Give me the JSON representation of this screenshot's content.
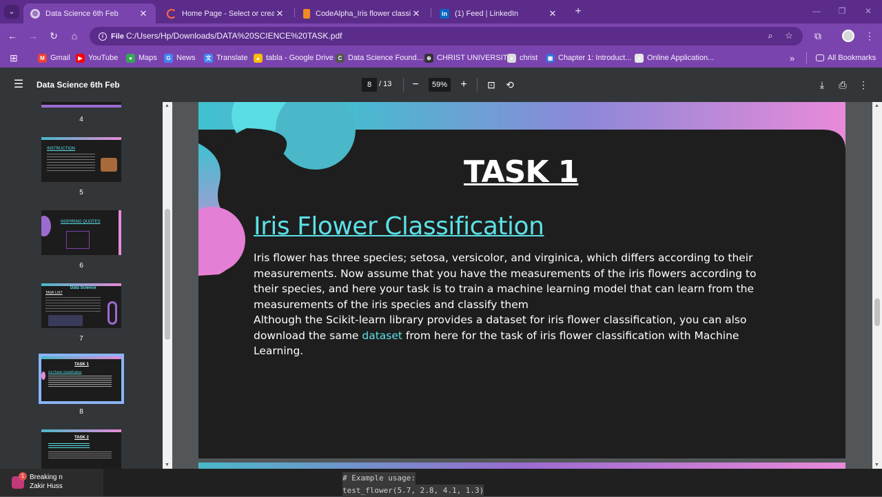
{
  "browser": {
    "tabs": [
      {
        "title": "Data Science 6th Feb",
        "active": true,
        "icon": "globe-icon"
      },
      {
        "title": "Home Page - Select or create a",
        "active": false,
        "icon": "spinner-icon"
      },
      {
        "title": "CodeAlpha_Iris flower classificat",
        "active": false,
        "icon": "document-icon"
      },
      {
        "title": "(1) Feed | LinkedIn",
        "active": false,
        "icon": "linkedin-icon"
      }
    ],
    "omnibox": {
      "chip": "File",
      "url": "C:/Users/Hp/Downloads/DATA%20SCIENCE%20TASK.pdf"
    },
    "bookmarks": [
      {
        "label": "Gmail",
        "color": "#ea4335",
        "glyph": "M"
      },
      {
        "label": "YouTube",
        "color": "#ff0000",
        "glyph": "▶"
      },
      {
        "label": "Maps",
        "color": "#34a853",
        "glyph": "●"
      },
      {
        "label": "News",
        "color": "#4285f4",
        "glyph": "G"
      },
      {
        "label": "Translate",
        "color": "#4285f4",
        "glyph": "文"
      },
      {
        "label": "tabla - Google Drive",
        "color": "#fbbc04",
        "glyph": "▲"
      },
      {
        "label": "Data Science Found...",
        "color": "#555555",
        "glyph": "C"
      },
      {
        "label": "CHRIST UNIVERSITY",
        "color": "#333333",
        "glyph": "⊕"
      },
      {
        "label": "christ",
        "color": "#dddddd",
        "glyph": "●"
      },
      {
        "label": "Chapter 1: Introduct...",
        "color": "#3a6fd8",
        "glyph": "▣"
      },
      {
        "label": "Online Application...",
        "color": "#e8e8e8",
        "glyph": "●"
      }
    ],
    "all_bookmarks": "All Bookmarks",
    "more": "»"
  },
  "pdf": {
    "title": "Data Science 6th Feb",
    "page_current": "8",
    "page_total": "/ 13",
    "zoom": "59%"
  },
  "sidebar": {
    "thumbnails": [
      {
        "num": "4",
        "label": ""
      },
      {
        "num": "5",
        "label": "INSTRUCTION"
      },
      {
        "num": "6",
        "label": "INSPIRING QUOTES"
      },
      {
        "num": "7",
        "label": "Data Science"
      },
      {
        "num": "8",
        "label": "TASK 1"
      },
      {
        "num": "",
        "label": "TASK 2"
      }
    ],
    "thumb7_sub": "TASK LIST",
    "thumb8_sub": "Iris Flower Classification"
  },
  "slide": {
    "heading": "TASK 1",
    "title": "Iris Flower Classification",
    "para1": "Iris flower has three species; setosa, versicolor, and virginica, which differs according to their measurements. Now assume that you have the measurements of the iris flowers according to their species, and here your task is to train a machine learning model that can learn from the measurements of the iris species and classify them",
    "para2_before": "Although the Scikit-learn library provides a dataset for iris flower classification, you can also download the same ",
    "para2_link": "dataset",
    "para2_after": " from here for the task of iris flower classification with Machine Learning."
  },
  "taskbar": {
    "news_line1": "Breaking n",
    "news_line2": "Zakir Huss",
    "news_badge": "1"
  },
  "code_overlay": {
    "line1": "# Example usage:",
    "line2": "test_flower(5.7, 2.8, 4.1, 1.3)"
  }
}
